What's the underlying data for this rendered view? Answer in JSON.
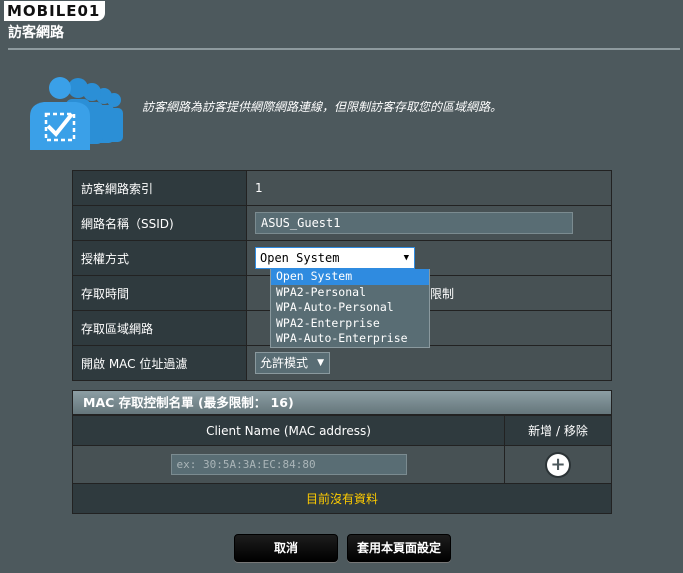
{
  "logo": {
    "text": "MOBILE01"
  },
  "page": {
    "title": "訪客網路",
    "description": "訪客網路為訪客提供網際網路連線，但限制訪客存取您的區域網路。"
  },
  "settings": {
    "rows": [
      {
        "label": "訪客網路索引",
        "value": "1"
      },
      {
        "label": "網路名稱（SSID)",
        "value": "ASUS_Guest1"
      },
      {
        "label": "授權方式",
        "value": "Open System"
      },
      {
        "label": "存取時間",
        "value": "限制"
      },
      {
        "label": "存取區域網路",
        "value": ""
      },
      {
        "label": "開啟 MAC 位址過濾",
        "value": "允許模式"
      }
    ]
  },
  "auth_dropdown": {
    "options": [
      "Open System",
      "WPA2-Personal",
      "WPA-Auto-Personal",
      "WPA2-Enterprise",
      "WPA-Auto-Enterprise"
    ],
    "selected_index": 0
  },
  "mac": {
    "title": "MAC 存取控制名單 (最多限制： 16)",
    "col_client": "Client Name (MAC address)",
    "col_action": "新增 / 移除",
    "input_placeholder": "ex: 30:5A:3A:EC:84:80",
    "empty_text": "目前沒有資料"
  },
  "buttons": {
    "cancel": "取消",
    "apply": "套用本頁面設定"
  },
  "colors": {
    "background": "#4d595d",
    "accent": "#2f8be0",
    "empty_text": "#ffcc00"
  }
}
